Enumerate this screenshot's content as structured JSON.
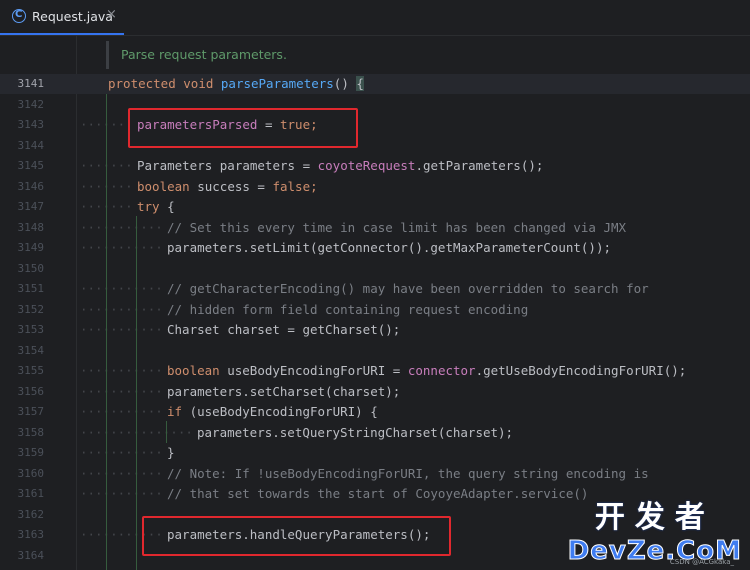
{
  "tab": {
    "icon": "class-c-icon",
    "label": "Request.java",
    "close": "×"
  },
  "doc_comment": "Parse request parameters.",
  "current_line": "3141",
  "lines": [
    {
      "n": "3141"
    },
    {
      "n": "3142"
    },
    {
      "n": "3143"
    },
    {
      "n": "3144"
    },
    {
      "n": "3145"
    },
    {
      "n": "3146"
    },
    {
      "n": "3147"
    },
    {
      "n": "3148"
    },
    {
      "n": "3149"
    },
    {
      "n": "3150"
    },
    {
      "n": "3151"
    },
    {
      "n": "3152"
    },
    {
      "n": "3153"
    },
    {
      "n": "3154"
    },
    {
      "n": "3155"
    },
    {
      "n": "3156"
    },
    {
      "n": "3157"
    },
    {
      "n": "3158"
    },
    {
      "n": "3159"
    },
    {
      "n": "3160"
    },
    {
      "n": "3161"
    },
    {
      "n": "3162"
    },
    {
      "n": "3163"
    },
    {
      "n": "3164"
    }
  ],
  "code": {
    "l3141": {
      "kw1": "protected",
      "kw2": "void",
      "fn": "parseParameters",
      "rest": "() ",
      "brace": "{"
    },
    "l3143": {
      "field": "parametersParsed",
      "op": " = ",
      "val": "true",
      "end": ";"
    },
    "l3145": {
      "a": "Parameters parameters = ",
      "field": "coyoteRequest",
      "b": ".getParameters();"
    },
    "l3146": {
      "kw": "boolean",
      "a": " success = ",
      "val": "false",
      "end": ";"
    },
    "l3147": {
      "kw": "try",
      "a": " {"
    },
    "l3148": {
      "comment": "// Set this every time in case limit has been changed via JMX"
    },
    "l3149": {
      "a": "parameters.setLimit(getConnector().getMaxParameterCount());"
    },
    "l3151": {
      "comment": "// getCharacterEncoding() may have been overridden to search for"
    },
    "l3152": {
      "comment": "// hidden form field containing request encoding"
    },
    "l3153": {
      "a": "Charset charset = getCharset();"
    },
    "l3155": {
      "kw": "boolean",
      "a": " useBodyEncodingForURI = ",
      "field": "connector",
      "b": ".getUseBodyEncodingForURI();"
    },
    "l3156": {
      "a": "parameters.setCharset(charset);"
    },
    "l3157": {
      "kw": "if",
      "a": " (useBodyEncodingForURI) {"
    },
    "l3158": {
      "a": "parameters.setQueryStringCharset(charset);"
    },
    "l3159": {
      "a": "}"
    },
    "l3160": {
      "comment": "// Note: If !useBodyEncodingForURI, the query string encoding is"
    },
    "l3161": {
      "comment": "// that set towards the start of CoyoyeAdapter.service()"
    },
    "l3163": {
      "a": "parameters.handleQueryParameters();"
    }
  },
  "watermark": {
    "cn": "开发者",
    "en": "DevZe.CoM",
    "small": "CSDN @ACGkaka_"
  },
  "colors": {
    "keyword": "#cf8e6d",
    "function": "#56a8f5",
    "field": "#c77dbb",
    "comment": "#7a7e85",
    "text": "#bcbec4",
    "highlight_box": "#e0282e"
  }
}
